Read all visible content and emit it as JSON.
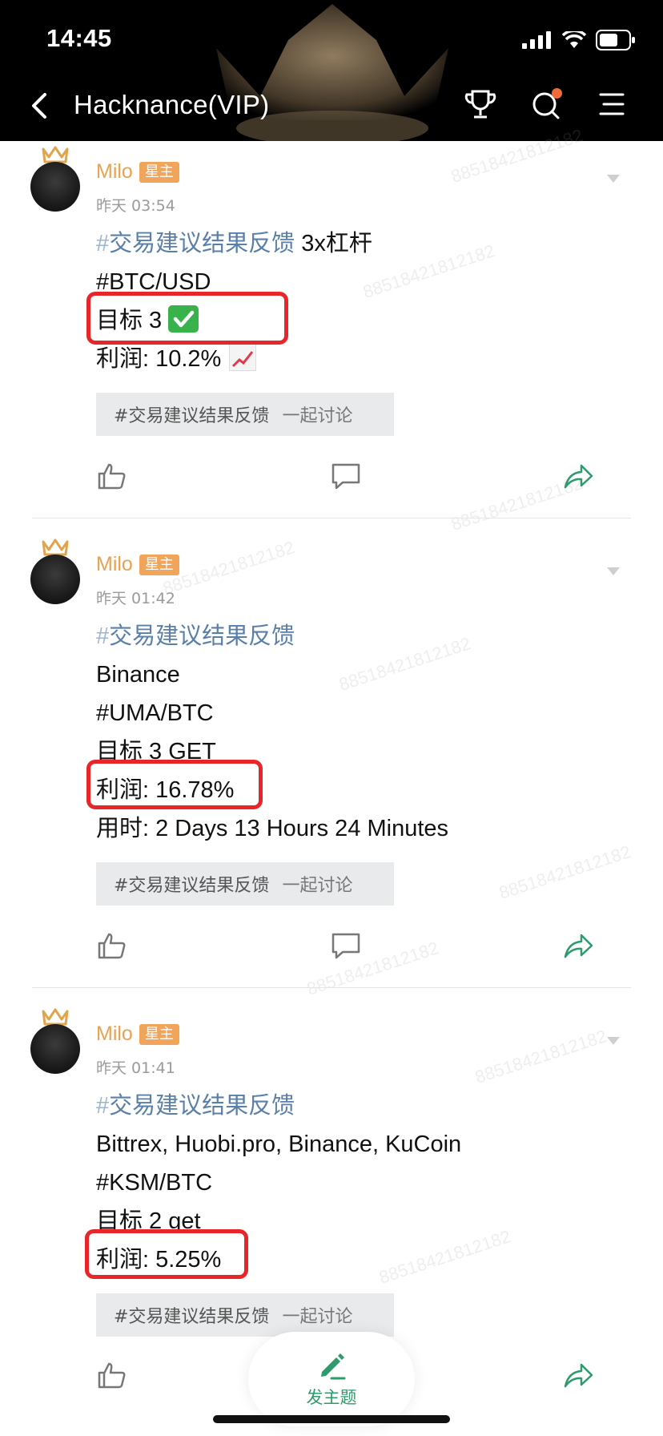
{
  "status_bar": {
    "time": "14:45"
  },
  "nav": {
    "title": "Hacknance(VIP)"
  },
  "watermark": "88518421812182",
  "posts": [
    {
      "author": "Milo",
      "badge": "星主",
      "time": "昨天 03:54",
      "hashtag": "交易建议结果反馈",
      "hashtag_suffix": " 3x杠杆",
      "lines": [
        "#BTC/USD",
        "目标 3"
      ],
      "profit": "利润: 10.2%",
      "tag_chip": "#交易建议结果反馈",
      "discuss": "一起讨论"
    },
    {
      "author": "Milo",
      "badge": "星主",
      "time": "昨天 01:42",
      "hashtag": "交易建议结果反馈",
      "hashtag_suffix": "",
      "lines": [
        "Binance",
        "#UMA/BTC",
        "目标 3 GET"
      ],
      "profit": "利润: 16.78%",
      "extra": "用时: 2 Days 13 Hours 24 Minutes",
      "tag_chip": "#交易建议结果反馈",
      "discuss": "一起讨论"
    },
    {
      "author": "Milo",
      "badge": "星主",
      "time": "昨天 01:41",
      "hashtag": "交易建议结果反馈",
      "hashtag_suffix": "",
      "lines": [
        "Bittrex, Huobi.pro, Binance, KuCoin",
        "#KSM/BTC",
        "目标 2  get"
      ],
      "profit": "利润: 5.25%",
      "tag_chip": "#交易建议结果反馈",
      "discuss": "一起讨论"
    }
  ],
  "compose": {
    "label": "发主题"
  },
  "icons": {
    "back": "chevron-left-icon",
    "trophy": "trophy-icon",
    "search": "search-icon",
    "menu": "menu-icon",
    "like": "thumbs-up-icon",
    "comment": "comment-icon",
    "share": "share-icon",
    "more": "chevron-down-icon",
    "compose": "pencil-icon"
  },
  "colors": {
    "accent_green": "#2f9a6b",
    "author_orange": "#e8a251",
    "highlight_red": "#e8262a",
    "notify_dot": "#f06a3a"
  }
}
